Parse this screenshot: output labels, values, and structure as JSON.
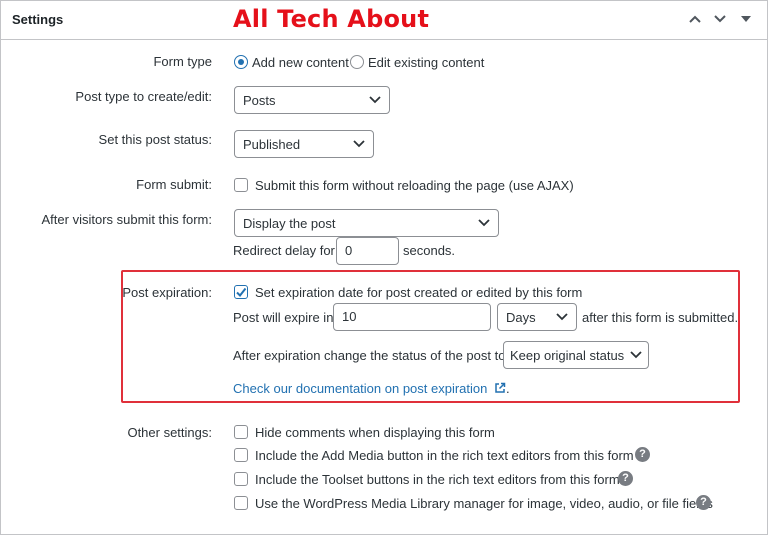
{
  "header": {
    "title": "Settings",
    "brand": "All Tech About"
  },
  "form_type": {
    "label": "Form type",
    "option_add": "Add new content",
    "option_edit": "Edit existing content",
    "selected": "Add new content"
  },
  "post_type": {
    "label": "Post type to create/edit:",
    "value": "Posts"
  },
  "post_status": {
    "label": "Set this post status:",
    "value": "Published"
  },
  "form_submit": {
    "label": "Form submit:",
    "checkbox_label": "Submit this form without reloading the page (use AJAX)",
    "checked": false
  },
  "after_submit": {
    "label": "After visitors submit this form:",
    "value": "Display the post",
    "redirect_label": "Redirect delay for:",
    "redirect_value": "0",
    "redirect_unit": "seconds."
  },
  "post_expiration": {
    "label": "Post expiration:",
    "checkbox_label": "Set expiration date for post created or edited by this form",
    "checked": true,
    "expire_prefix": "Post will expire in",
    "expire_value": "10",
    "expire_unit": "Days",
    "expire_suffix": "after this form is submitted.",
    "status_label": "After expiration change the status of the post to",
    "status_value": "Keep original status",
    "doc_link": "Check our documentation on post expiration",
    "doc_link_end": "."
  },
  "other_settings": {
    "label": "Other settings:",
    "options": [
      {
        "label": "Hide comments when displaying this form",
        "checked": false,
        "help": false
      },
      {
        "label": "Include the Add Media button in the rich text editors from this form",
        "checked": false,
        "help": true
      },
      {
        "label": "Include the Toolset buttons in the rich text editors from this form",
        "checked": false,
        "help": true
      },
      {
        "label": "Use the WordPress Media Library manager for image, video, audio, or file fields",
        "checked": false,
        "help": true
      }
    ]
  },
  "colors": {
    "accent": "#2271b1",
    "brand": "#e5101a",
    "highlight_box": "#e0303a"
  },
  "icons": {
    "collapse_up": "chevron-up-icon",
    "move_down": "chevron-down-icon",
    "toggle": "triangle-down-icon",
    "help": "question-icon",
    "external": "external-link-icon"
  }
}
